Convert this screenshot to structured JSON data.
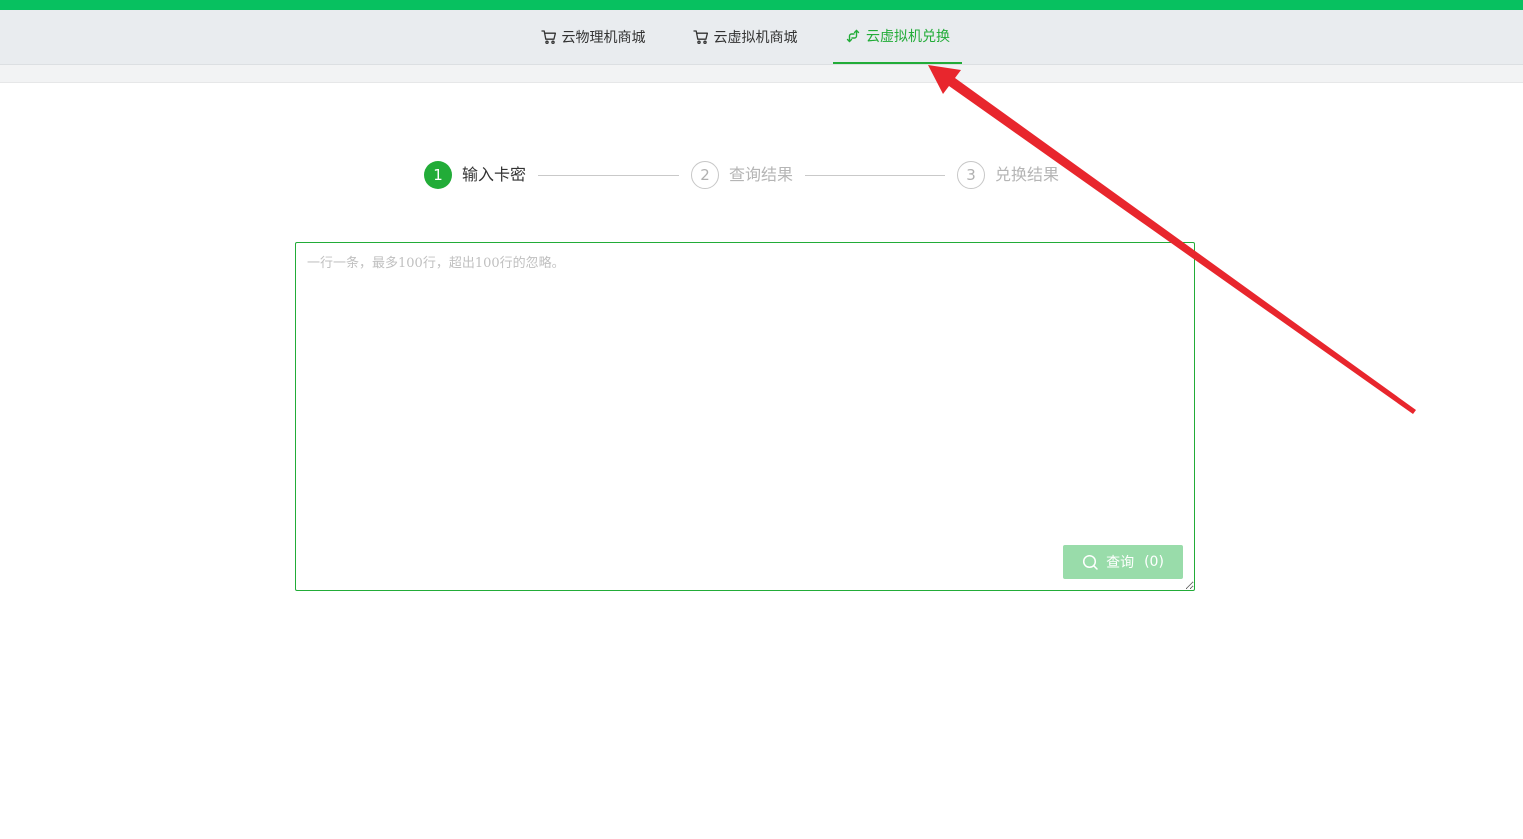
{
  "nav": {
    "tabs": [
      {
        "label": "云物理机商城",
        "icon": "cart-icon"
      },
      {
        "label": "云虚拟机商城",
        "icon": "cart-icon"
      },
      {
        "label": "云虚拟机兑换",
        "icon": "exchange-icon",
        "active": true
      }
    ]
  },
  "steps": [
    {
      "number": "1",
      "label": "输入卡密",
      "state": "active"
    },
    {
      "number": "2",
      "label": "查询结果",
      "state": "pending"
    },
    {
      "number": "3",
      "label": "兑换结果",
      "state": "pending"
    }
  ],
  "input": {
    "placeholder": "一行一条，最多100行，超出100行的忽略。",
    "value": ""
  },
  "query_button": {
    "label": "查询",
    "count": "(0)",
    "icon": "search-icon"
  },
  "colors": {
    "brand_bar": "#07c160",
    "accent": "#22ac38",
    "nav_bg": "#e9ecef",
    "button_disabled": "#99dcaa",
    "annotation_arrow": "#e8262d"
  }
}
